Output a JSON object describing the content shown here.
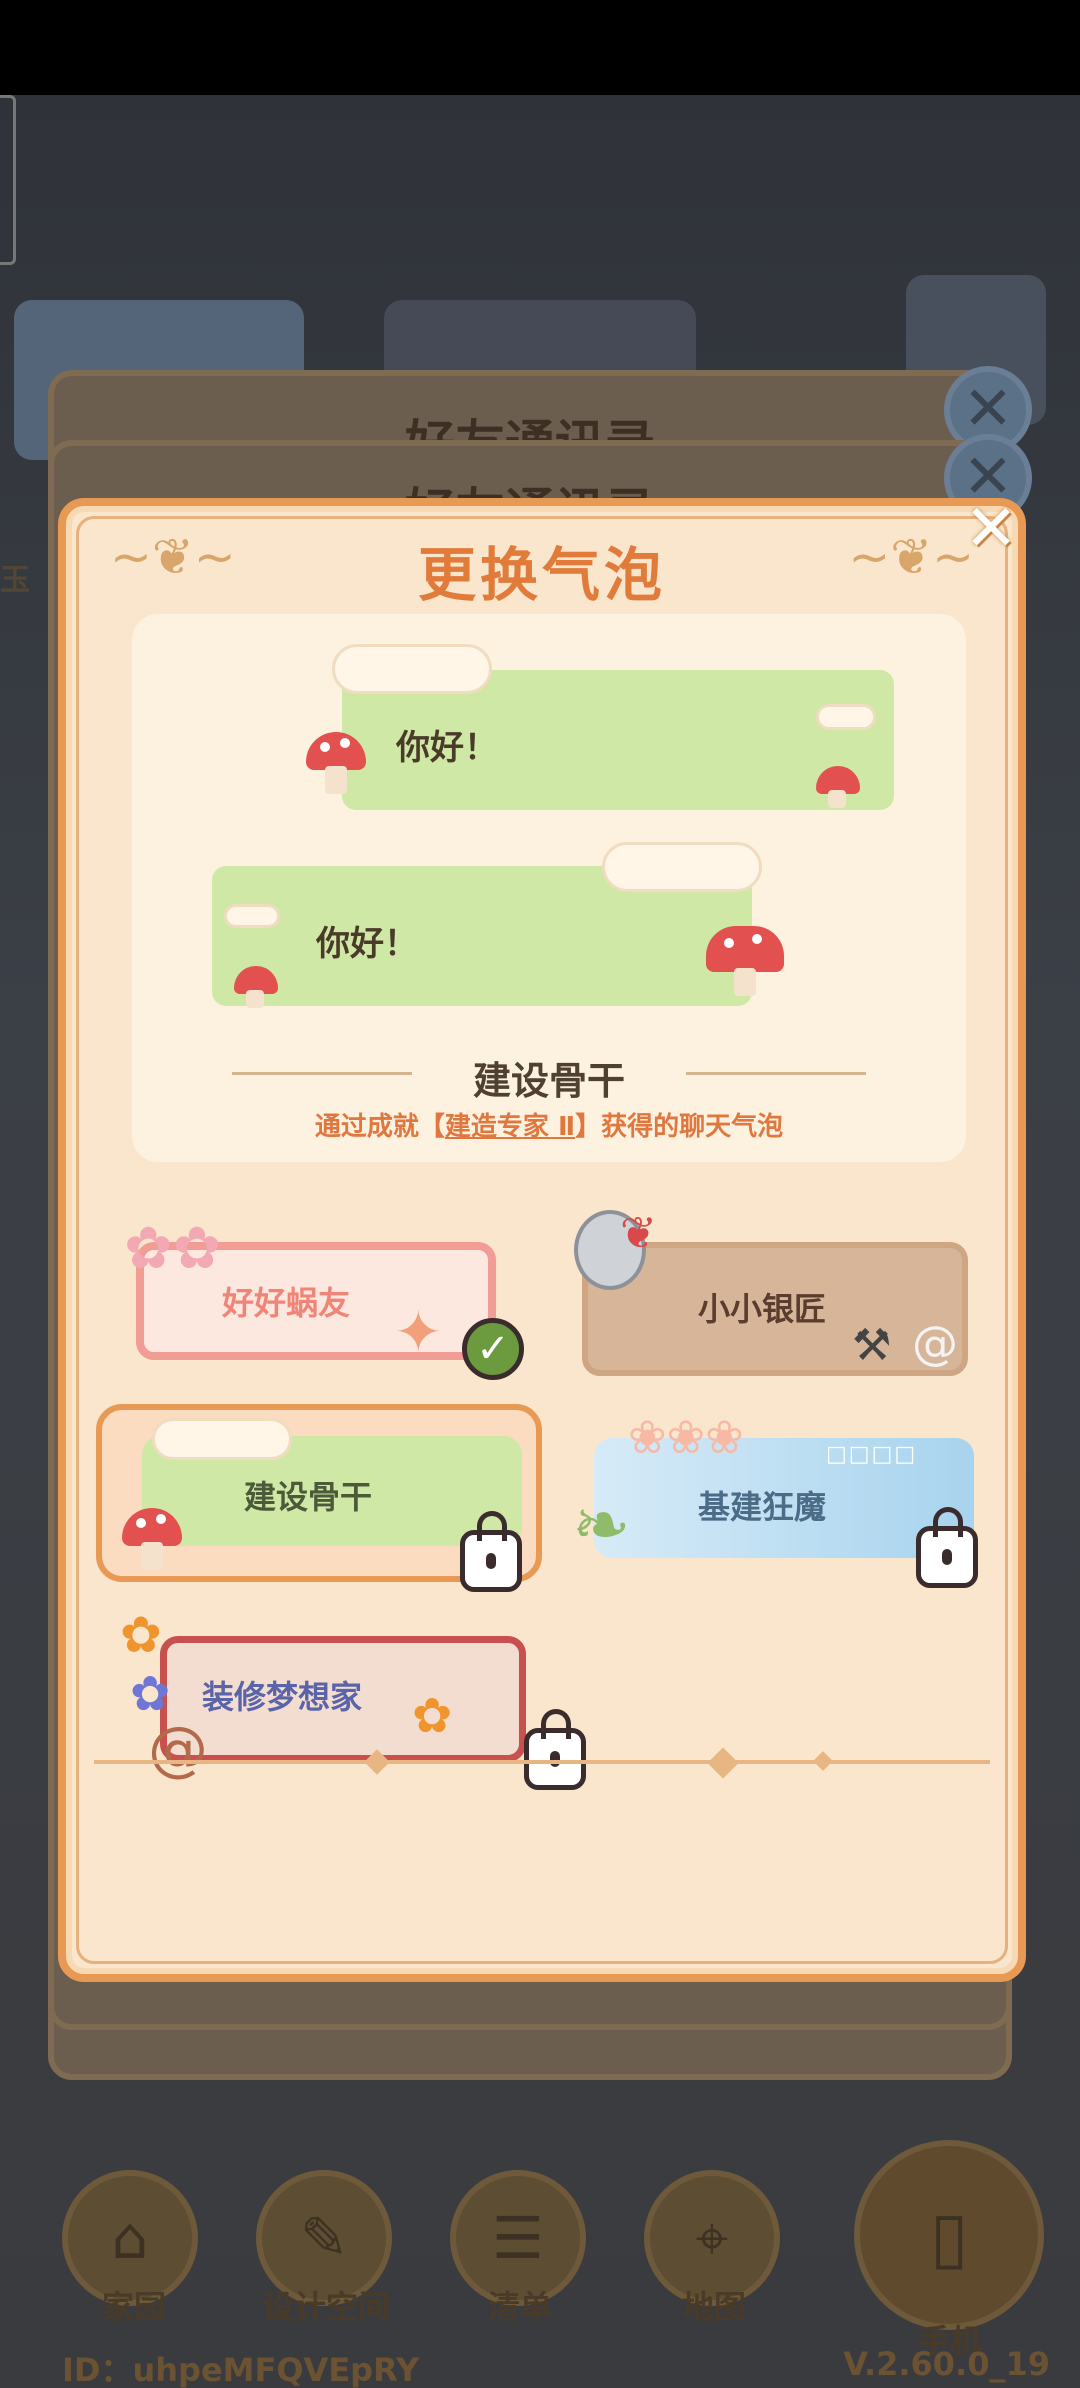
{
  "background": {
    "window_title": "好友通讯录",
    "nav": [
      {
        "label": "家园",
        "icon": "house-icon"
      },
      {
        "label": "设计空间",
        "icon": "ruler-icon"
      },
      {
        "label": "清单",
        "icon": "list-icon"
      },
      {
        "label": "地图",
        "icon": "map-pin-icon"
      },
      {
        "label": "手机",
        "icon": "phone-icon"
      }
    ],
    "side_label": "玉",
    "user_id": "ID：uhpeMFQVEpRY",
    "version": "V.2.60.0_19"
  },
  "modal": {
    "title": "更换气泡",
    "close": "✕",
    "preview": {
      "bubble_text_1": "你好！",
      "bubble_text_2": "你好！",
      "name": "建设骨干",
      "desc_prefix": "通过成就【",
      "desc_link": "建造专家 Ⅱ",
      "desc_suffix": "】获得的聊天气泡"
    },
    "items": [
      {
        "label": "好好蜗友",
        "state": "equipped"
      },
      {
        "label": "小小银匠",
        "state": "unlocked"
      },
      {
        "label": "建设骨干",
        "state": "locked-selected"
      },
      {
        "label": "基建狂魔",
        "state": "locked"
      },
      {
        "label": "装修梦想家",
        "state": "locked"
      }
    ]
  },
  "colors": {
    "accent": "#e07b3a",
    "panel": "#f9e6cc",
    "bubble_green": "#cfe8a6"
  }
}
